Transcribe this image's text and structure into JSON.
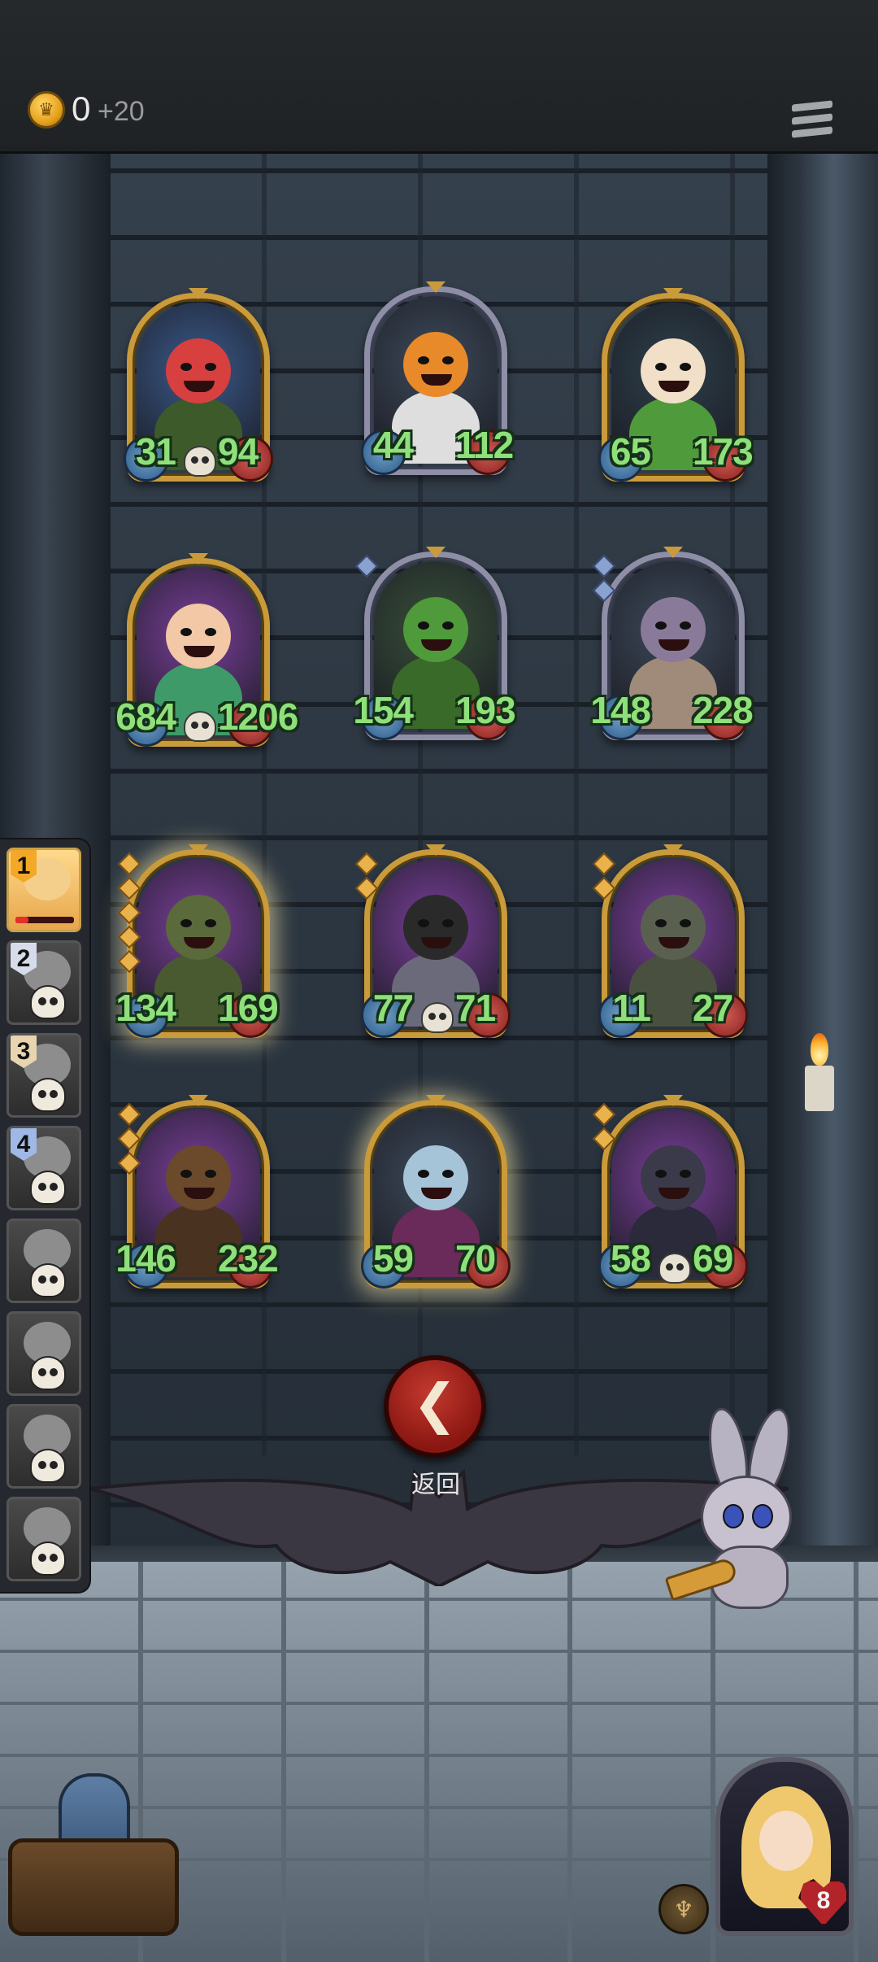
{
  "currency": {
    "amount": "0",
    "bonus": "+20",
    "icon": "crown-coin-icon"
  },
  "menu": {
    "icon": "menu-icon"
  },
  "cards": [
    {
      "atk": "31",
      "hp": "94",
      "frame": "gold",
      "bg": "#3a5a8a",
      "face": "#d84040",
      "body": "#3c5a2a",
      "skull": true,
      "gems": 0,
      "glow": false,
      "name_hint": "red-devil-card"
    },
    {
      "atk": "44",
      "hp": "112",
      "frame": "silver",
      "bg": "#3d4a5a",
      "face": "#e88a2a",
      "body": "#dedede",
      "skull": false,
      "gems": 0,
      "glow": false,
      "name_hint": "pumpkin-card"
    },
    {
      "atk": "65",
      "hp": "173",
      "frame": "gold",
      "bg": "#2d3f4a",
      "face": "#f1dfc8",
      "body": "#4f9a3a",
      "skull": false,
      "gems": 0,
      "glow": false,
      "name_hint": "leaf-girl-card"
    },
    {
      "atk": "684",
      "hp": "1206",
      "frame": "gold",
      "bg": "#7a3f9a",
      "face": "#f2c8a6",
      "body": "#3f9a6a",
      "skull": true,
      "gems": 0,
      "glow": false,
      "name_hint": "fairy-card"
    },
    {
      "atk": "154",
      "hp": "193",
      "frame": "silver",
      "bg": "#38503a",
      "face": "#4f9a3a",
      "body": "#3a6a2a",
      "skull": false,
      "gems": 1,
      "gem_color": "blue",
      "glow": false,
      "name_hint": "plant-monster-card"
    },
    {
      "atk": "148",
      "hp": "228",
      "frame": "silver",
      "bg": "#3d4a5a",
      "face": "#8a7a9a",
      "body": "#a08a7a",
      "skull": false,
      "gems": 2,
      "gem_color": "blue",
      "glow": false,
      "name_hint": "mushroom-card"
    },
    {
      "atk": "134",
      "hp": "169",
      "frame": "gold",
      "bg": "#7a3f9a",
      "face": "#5a6a3a",
      "body": "#4a5a30",
      "skull": false,
      "gems": 5,
      "gem_color": "gold",
      "glow": true,
      "name_hint": "rock-golem-card"
    },
    {
      "atk": "77",
      "hp": "71",
      "frame": "gold",
      "bg": "#7a3f9a",
      "face": "#2a2a2a",
      "body": "#6a6a7a",
      "skull": true,
      "gems": 2,
      "gem_color": "gold",
      "glow": false,
      "name_hint": "hedgehog-bandit-card"
    },
    {
      "atk": "11",
      "hp": "27",
      "frame": "gold",
      "bg": "#7a3f9a",
      "face": "#5a6050",
      "body": "#4a5040",
      "skull": false,
      "gems": 2,
      "gem_color": "gold",
      "glow": false,
      "name_hint": "stone-troll-card"
    },
    {
      "atk": "146",
      "hp": "232",
      "frame": "gold",
      "bg": "#7a3f9a",
      "face": "#6a4a2a",
      "body": "#4a3220",
      "skull": false,
      "gems": 3,
      "gem_color": "gold",
      "glow": false,
      "name_hint": "tiki-totem-card"
    },
    {
      "atk": "59",
      "hp": "70",
      "frame": "gold",
      "bg": "#3d4a5a",
      "face": "#a6c4d8",
      "body": "#6a2a5a",
      "skull": false,
      "gems": 0,
      "glow": true,
      "name_hint": "dark-elf-card"
    },
    {
      "atk": "58",
      "hp": "69",
      "frame": "gold",
      "bg": "#7a3f9a",
      "face": "#3a3a4a",
      "body": "#2a2a3a",
      "skull": true,
      "gems": 2,
      "gem_color": "gold",
      "glow": false,
      "name_hint": "shadow-pony-card"
    }
  ],
  "roster": [
    {
      "rank": "1",
      "rank_color": "gold",
      "active": true
    },
    {
      "rank": "2",
      "rank_color": "silver",
      "active": false
    },
    {
      "rank": "3",
      "rank_color": "tan",
      "active": false
    },
    {
      "rank": "4",
      "rank_color": "blue",
      "active": false
    },
    {
      "rank": "",
      "active": false
    },
    {
      "rank": "",
      "active": false
    },
    {
      "rank": "",
      "active": false
    },
    {
      "rank": "",
      "active": false
    }
  ],
  "back": {
    "label": "返回",
    "icon": "arrow-left-icon"
  },
  "hero": {
    "hearts": "8",
    "icon": "heart-icon"
  }
}
